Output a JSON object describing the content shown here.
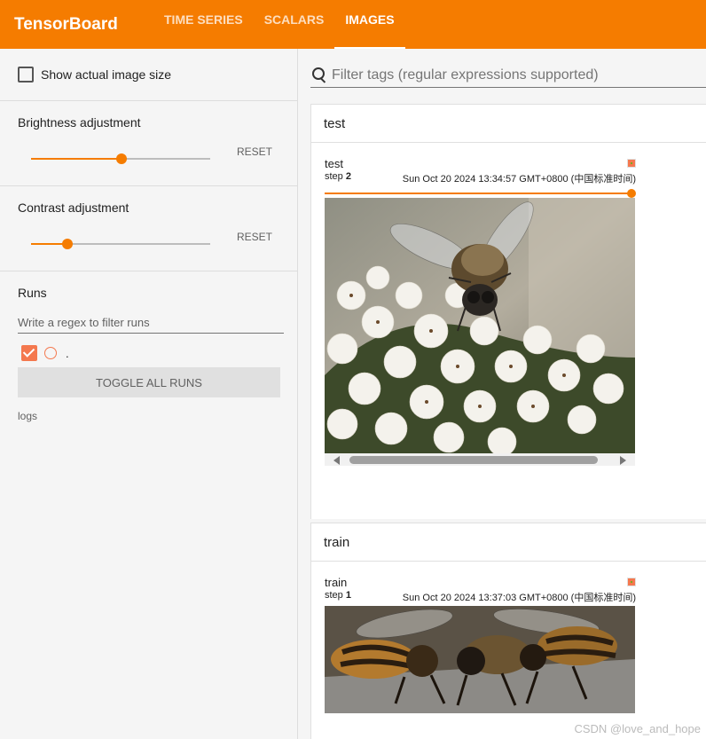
{
  "app": {
    "title": "TensorBoard"
  },
  "tabs": [
    {
      "label": "TIME SERIES"
    },
    {
      "label": "SCALARS"
    },
    {
      "label": "IMAGES"
    }
  ],
  "sidebar": {
    "show_actual_size": "Show actual image size",
    "brightness": {
      "label": "Brightness adjustment",
      "reset": "RESET",
      "value": 0.5
    },
    "contrast": {
      "label": "Contrast adjustment",
      "reset": "RESET",
      "value": 0.2
    },
    "runs": {
      "title": "Runs",
      "filter_placeholder": "Write a regex to filter runs",
      "items": [
        {
          "name": ".",
          "color": "#f4784e"
        }
      ],
      "toggle_label": "TOGGLE ALL RUNS",
      "logdir": "logs"
    }
  },
  "main": {
    "filter_placeholder": "Filter tags (regular expressions supported)",
    "groups": [
      {
        "name": "test",
        "card": {
          "title": "test",
          "step_label": "step",
          "step": "2",
          "timestamp": "Sun Oct 20 2024 13:34:57 GMT+0800 (中国标准时间)"
        }
      },
      {
        "name": "train",
        "card": {
          "title": "train",
          "step_label": "step",
          "step": "1",
          "timestamp": "Sun Oct 20 2024 13:37:03 GMT+0800 (中国标准时间)"
        }
      }
    ]
  },
  "watermark": "CSDN @love_and_hope"
}
